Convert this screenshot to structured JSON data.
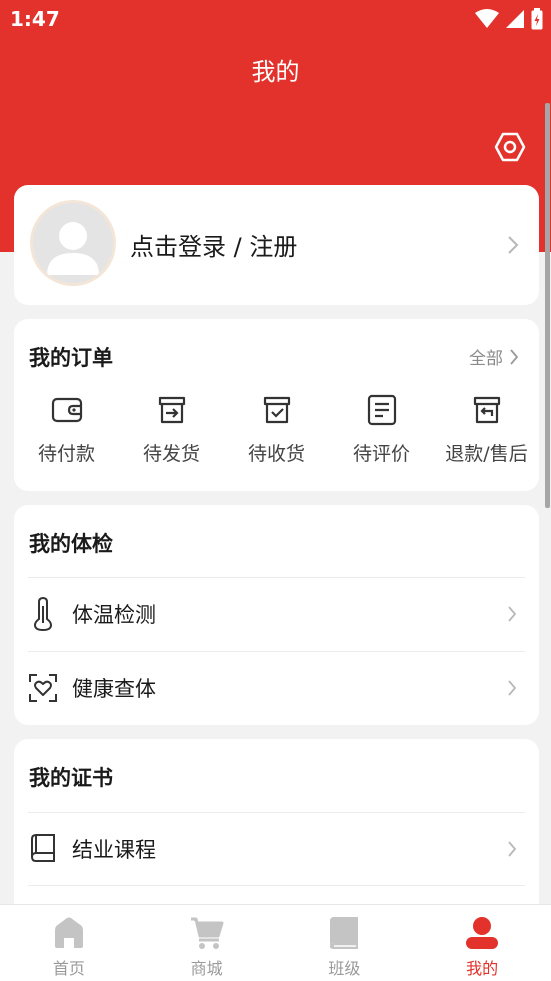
{
  "status_bar": {
    "time": "1:47"
  },
  "header": {
    "title": "我的"
  },
  "login": {
    "text": "点击登录 / 注册"
  },
  "orders": {
    "title": "我的订单",
    "all_label": "全部",
    "items": [
      {
        "label": "待付款",
        "icon": "wallet-icon"
      },
      {
        "label": "待发货",
        "icon": "box-arrow-icon"
      },
      {
        "label": "待收货",
        "icon": "box-check-icon"
      },
      {
        "label": "待评价",
        "icon": "document-icon"
      },
      {
        "label": "退款/售后",
        "icon": "box-return-icon"
      }
    ]
  },
  "health": {
    "title": "我的体检",
    "items": [
      {
        "label": "体温检测",
        "icon": "thermometer-icon"
      },
      {
        "label": "健康查体",
        "icon": "heart-scan-icon"
      }
    ]
  },
  "certificates": {
    "title": "我的证书",
    "items": [
      {
        "label": "结业课程",
        "icon": "book-icon"
      }
    ]
  },
  "tabbar": {
    "tabs": [
      {
        "label": "首页",
        "icon": "home-icon",
        "active": false
      },
      {
        "label": "商城",
        "icon": "cart-icon",
        "active": false
      },
      {
        "label": "班级",
        "icon": "class-book-icon",
        "active": false
      },
      {
        "label": "我的",
        "icon": "profile-icon",
        "active": true
      }
    ]
  },
  "colors": {
    "primary": "#e3312b",
    "background": "#f2f2f2",
    "inactive": "#c4c4c4"
  }
}
